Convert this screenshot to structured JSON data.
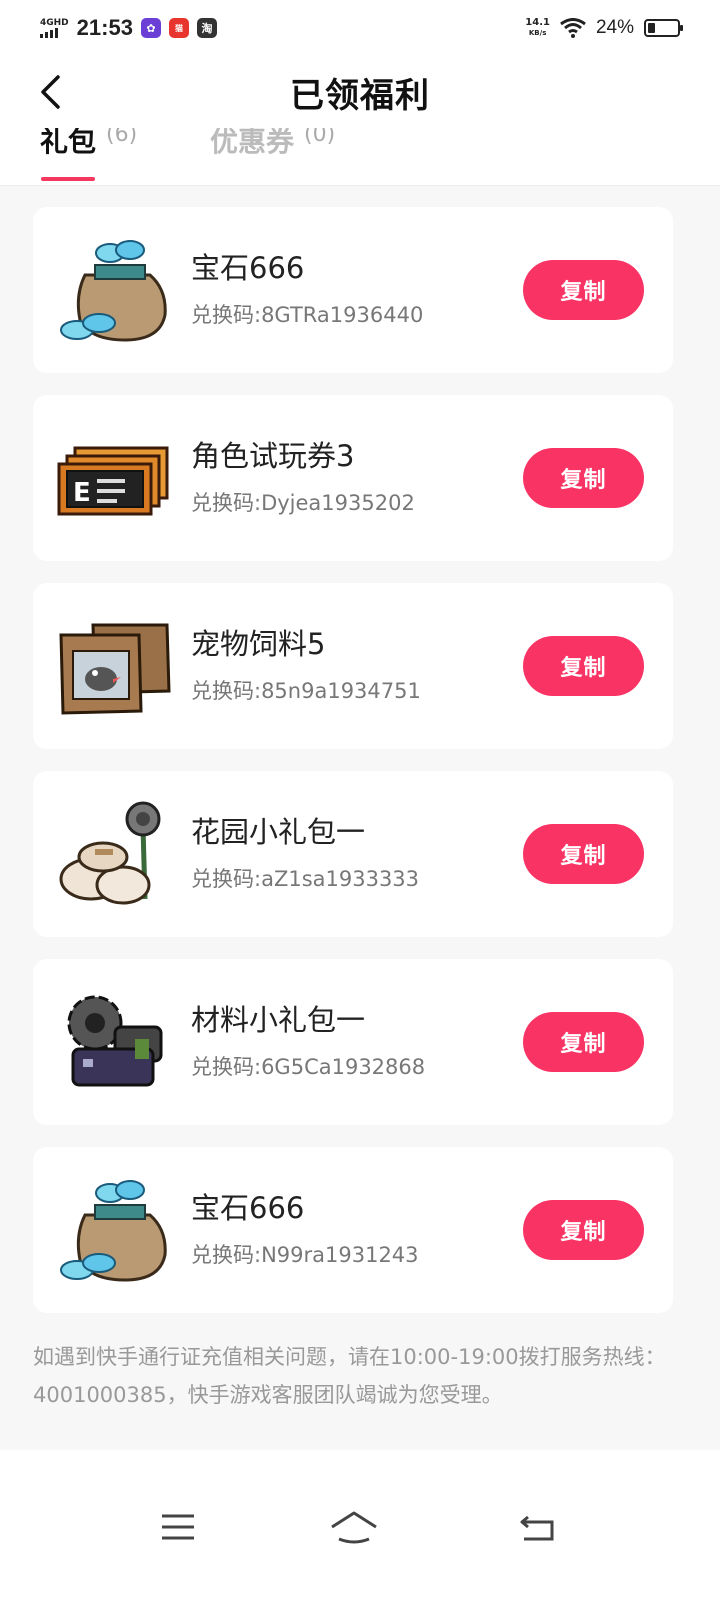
{
  "status_bar": {
    "network": "4GHD",
    "time": "21:53",
    "speed_value": "14.1",
    "speed_unit": "KB/s",
    "battery_percent": "24%",
    "icons": [
      "signal-icon",
      "app-notification-icon",
      "tmall-icon",
      "taobao-icon",
      "wifi-icon",
      "battery-icon"
    ]
  },
  "header": {
    "title": "已领福利",
    "back_icon": "chevron-left-icon"
  },
  "tabs": [
    {
      "label": "礼包",
      "count": "(6)",
      "active": true
    },
    {
      "label": "优惠券",
      "count": "(0)",
      "active": false
    }
  ],
  "colors": {
    "accent": "#f93363",
    "tab_indicator": "#f4375e",
    "background": "#f7f7f7"
  },
  "gifts": [
    {
      "title": "宝石666",
      "code": "兑换码:8GTRa1936440",
      "button": "复制",
      "icon": "gem-bag-icon"
    },
    {
      "title": "角色试玩券3",
      "code": "兑换码:Dyjea1935202",
      "button": "复制",
      "icon": "ticket-icon"
    },
    {
      "title": "宠物饲料5",
      "code": "兑换码:85n9a1934751",
      "button": "复制",
      "icon": "pet-food-icon"
    },
    {
      "title": "花园小礼包一",
      "code": "兑换码:aZ1sa1933333",
      "button": "复制",
      "icon": "garden-bags-icon"
    },
    {
      "title": "材料小礼包一",
      "code": "兑换码:6G5Ca1932868",
      "button": "复制",
      "icon": "gear-materials-icon"
    },
    {
      "title": "宝石666",
      "code": "兑换码:N99ra1931243",
      "button": "复制",
      "icon": "gem-bag-icon"
    }
  ],
  "notice": "如遇到快手通行证充值相关问题，请在10:00-19:00拨打服务热线：4001000385，快手游戏客服团队竭诚为您受理。",
  "nav_bar": {
    "icons": [
      "menu-icon",
      "home-icon",
      "back-icon"
    ]
  }
}
